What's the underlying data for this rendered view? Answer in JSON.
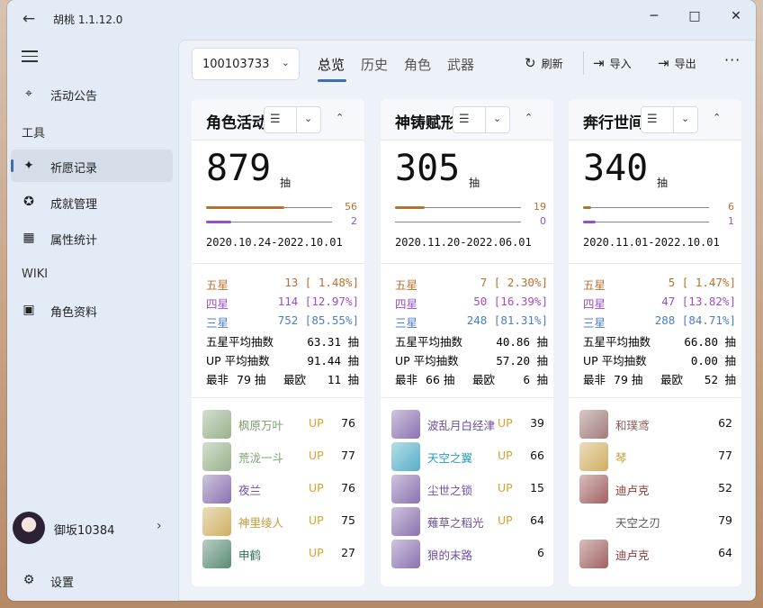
{
  "app": {
    "title": "胡桃 1.1.12.0",
    "back_icon": "arrow-left-icon"
  },
  "window_controls": {
    "minimize": "─",
    "maximize": "□",
    "close": "✕"
  },
  "sidebar": {
    "items": [
      {
        "label": "活动公告",
        "icon": "compass-icon"
      },
      {
        "label": "祈愿记录",
        "icon": "sparkle-icon",
        "selected": true
      },
      {
        "label": "成就管理",
        "icon": "trophy-icon"
      },
      {
        "label": "属性统计",
        "icon": "chart-icon"
      },
      {
        "label": "角色资料",
        "icon": "character-icon"
      }
    ],
    "groups": {
      "tools": "工具",
      "wiki": "WIKI"
    },
    "user": {
      "name": "御坂10384",
      "chevron": "›"
    },
    "settings": {
      "label": "设置"
    }
  },
  "toolbar": {
    "uid": "100103733",
    "tabs": [
      "总览",
      "历史",
      "角色",
      "武器"
    ],
    "active_tab": "总览",
    "refresh": "刷新",
    "import": "导入",
    "export": "导出",
    "more": "···",
    "icons": {
      "refresh": "↻",
      "import": "⇥",
      "export": "⇥"
    }
  },
  "colors": {
    "five_star": "#b8712e",
    "four_star": "#9b4fc4",
    "three_star": "#4b7ec3",
    "up": "#d8a12d",
    "accent": "#3b6fb6"
  },
  "cards": [
    {
      "title": "角色活动",
      "total": "879",
      "unit": "抽",
      "pity5": 56,
      "pity4": 2,
      "pity5_max": 90,
      "pity4_max": 10,
      "range": "2020.10.24-2022.10.01",
      "stats": {
        "five": "13 [ 1.48%]",
        "four": "114 [12.97%]",
        "three": "752 [85.55%]",
        "avg5_label": "五星平均抽数",
        "avg5": "63.31 抽",
        "avgup_label": "UP 平均抽数",
        "avgup": "91.44 抽",
        "worst_label": "最非",
        "worst": "79 抽",
        "best_label": "最欧",
        "best": "11 抽"
      },
      "items": [
        {
          "name": "枫原万叶",
          "up": "UP",
          "count": "76",
          "color": "#7f9e6e"
        },
        {
          "name": "荒泷一斗",
          "up": "UP",
          "count": "77",
          "color": "#7f9e6e"
        },
        {
          "name": "夜兰",
          "up": "UP",
          "count": "76",
          "color": "#6d4f9c"
        },
        {
          "name": "神里绫人",
          "up": "UP",
          "count": "75",
          "color": "#c49a3a"
        },
        {
          "name": "申鹤",
          "up": "UP",
          "count": "27",
          "color": "#2f6e50"
        }
      ]
    },
    {
      "title": "神铸赋形",
      "total": "305",
      "unit": "抽",
      "pity5": 19,
      "pity4": 0,
      "pity5_max": 80,
      "pity4_max": 10,
      "range": "2020.11.20-2022.06.01",
      "stats": {
        "five": "7 [ 2.30%]",
        "four": "50 [16.39%]",
        "three": "248 [81.31%]",
        "avg5_label": "五星平均抽数",
        "avg5": "40.86 抽",
        "avgup_label": "UP 平均抽数",
        "avgup": "57.20 抽",
        "worst_label": "最非",
        "worst": "66 抽",
        "best_label": "最欧",
        "best": "6 抽"
      },
      "items": [
        {
          "name": "波乱月白经津",
          "up": "UP",
          "count": "39",
          "color": "#6d4f9c"
        },
        {
          "name": "天空之翼",
          "up": "UP",
          "count": "66",
          "color": "#2a9ab8"
        },
        {
          "name": "尘世之锁",
          "up": "UP",
          "count": "15",
          "color": "#6d4f9c"
        },
        {
          "name": "薙草之稻光",
          "up": "UP",
          "count": "64",
          "color": "#6d4f9c"
        },
        {
          "name": "狼的末路",
          "up": "",
          "count": "6",
          "color": "#6d4f9c"
        }
      ]
    },
    {
      "title": "奔行世间",
      "total": "340",
      "unit": "抽",
      "pity5": 6,
      "pity4": 1,
      "pity5_max": 90,
      "pity4_max": 10,
      "range": "2020.11.01-2022.10.01",
      "stats": {
        "five": "5 [ 1.47%]",
        "four": "47 [13.82%]",
        "three": "288 [84.71%]",
        "avg5_label": "五星平均抽数",
        "avg5": "66.80 抽",
        "avgup_label": "UP 平均抽数",
        "avgup": "0.00 抽",
        "worst_label": "最非",
        "worst": "79 抽",
        "best_label": "最欧",
        "best": "52 抽"
      },
      "items": [
        {
          "name": "和璞鸢",
          "up": "",
          "count": "62",
          "color": "#8a5a5a"
        },
        {
          "name": "琴",
          "up": "",
          "count": "77",
          "color": "#c49a3a"
        },
        {
          "name": "迪卢克",
          "up": "",
          "count": "52",
          "color": "#8a3a3a"
        },
        {
          "name": "天空之刃",
          "up": "",
          "count": "79",
          "color": "#555"
        },
        {
          "name": "迪卢克",
          "up": "",
          "count": "64",
          "color": "#8a3a3a"
        }
      ]
    }
  ],
  "star_labels": {
    "five": "五星",
    "four": "四星",
    "three": "三星"
  }
}
